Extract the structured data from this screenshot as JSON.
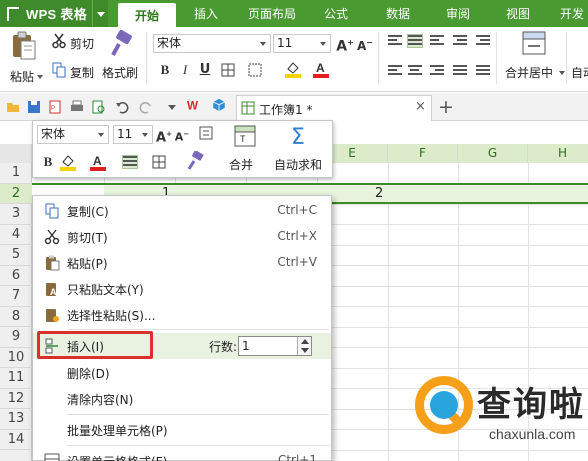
{
  "app": {
    "name": "WPS 表格"
  },
  "tabs": [
    "开始",
    "插入",
    "页面布局",
    "公式",
    "数据",
    "审阅",
    "视图",
    "开发"
  ],
  "ribbon": {
    "paste": "粘贴",
    "cut": "剪切",
    "copy": "复制",
    "format_painter": "格式刷",
    "font_name": "宋体",
    "font_size": "11",
    "merge_center": "合并居中",
    "auto_wrap": "自动"
  },
  "quick_access": {
    "document": "工作簿1 *"
  },
  "mini_toolbar": {
    "font_name": "宋体",
    "font_size": "11",
    "merge": "合并",
    "autosum": "自动求和"
  },
  "sheet": {
    "columns": [
      "E",
      "F",
      "G",
      "H"
    ],
    "rows": [
      "1",
      "2",
      "3",
      "4",
      "5",
      "6",
      "7",
      "8",
      "9",
      "10",
      "11",
      "12",
      "13",
      "14"
    ],
    "cells": {
      "b2": "1",
      "e2": "2"
    }
  },
  "context_menu": {
    "items": [
      {
        "label": "复制(C)",
        "shortcut": "Ctrl+C"
      },
      {
        "label": "剪切(T)",
        "shortcut": "Ctrl+X"
      },
      {
        "label": "粘贴(P)",
        "shortcut": "Ctrl+V"
      },
      {
        "label": "只粘贴文本(Y)",
        "shortcut": ""
      },
      {
        "label": "选择性粘贴(S)...",
        "shortcut": ""
      },
      {
        "label": "插入(I)",
        "shortcut": ""
      },
      {
        "label": "删除(D)",
        "shortcut": ""
      },
      {
        "label": "清除内容(N)",
        "shortcut": ""
      },
      {
        "label": "批量处理单元格(P)",
        "shortcut": ""
      },
      {
        "label": "设置单元格格式(F)...",
        "shortcut": "Ctrl+1"
      }
    ],
    "rows_label": "行数:",
    "rows_value": "1"
  },
  "watermark": {
    "brand": "查询啦",
    "url": "chaxunla.com"
  },
  "colors": {
    "title_green": "#4a9a32",
    "dark_green": "#3f8a2b",
    "highlight_red": "#d9302e",
    "selected_row": "#e8f3de",
    "watermark_orange": "#f5a018",
    "watermark_blue": "#2aa4dd"
  }
}
